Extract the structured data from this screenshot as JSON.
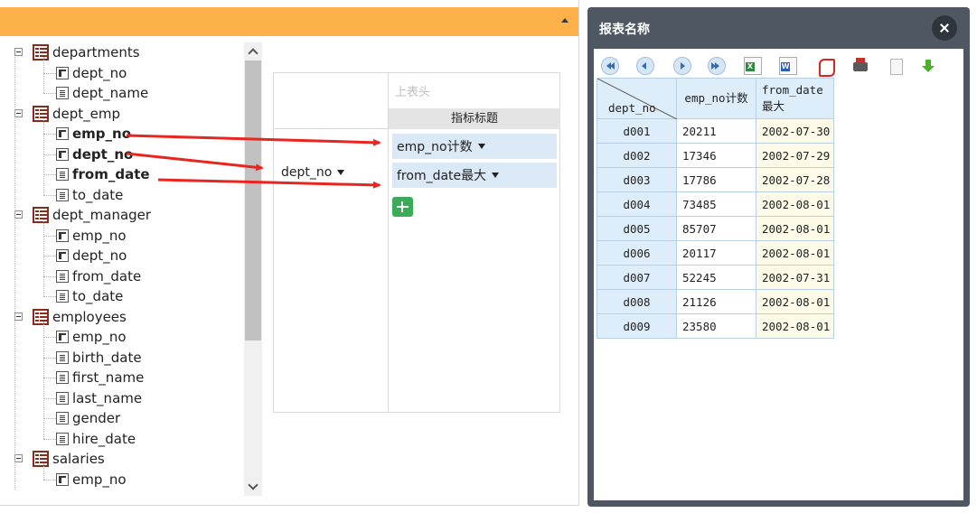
{
  "tree": {
    "tables": [
      {
        "name": "departments",
        "fields": [
          {
            "name": "dept_no",
            "type": "key",
            "bold": false
          },
          {
            "name": "dept_name",
            "type": "col",
            "bold": false
          }
        ]
      },
      {
        "name": "dept_emp",
        "fields": [
          {
            "name": "emp_no",
            "type": "key",
            "bold": true
          },
          {
            "name": "dept_no",
            "type": "key",
            "bold": true
          },
          {
            "name": "from_date",
            "type": "col",
            "bold": true
          },
          {
            "name": "to_date",
            "type": "col",
            "bold": false
          }
        ]
      },
      {
        "name": "dept_manager",
        "fields": [
          {
            "name": "emp_no",
            "type": "key",
            "bold": false
          },
          {
            "name": "dept_no",
            "type": "key",
            "bold": false
          },
          {
            "name": "from_date",
            "type": "col",
            "bold": false
          },
          {
            "name": "to_date",
            "type": "col",
            "bold": false
          }
        ]
      },
      {
        "name": "employees",
        "fields": [
          {
            "name": "emp_no",
            "type": "key",
            "bold": false
          },
          {
            "name": "birth_date",
            "type": "col",
            "bold": false
          },
          {
            "name": "first_name",
            "type": "col",
            "bold": false
          },
          {
            "name": "last_name",
            "type": "col",
            "bold": false
          },
          {
            "name": "gender",
            "type": "col",
            "bold": false
          },
          {
            "name": "hire_date",
            "type": "col",
            "bold": false
          }
        ]
      },
      {
        "name": "salaries",
        "fields": [
          {
            "name": "emp_no",
            "type": "key",
            "bold": false
          }
        ]
      }
    ]
  },
  "pivot": {
    "col_header_placeholder": "上表头",
    "metric_title": "指标标题",
    "row_dimension": "dept_no",
    "measures": [
      "emp_no计数",
      "from_date最大"
    ]
  },
  "dialog": {
    "title": "报表名称",
    "toolbar": [
      "first-page-icon",
      "prev-page-icon",
      "next-page-icon",
      "last-page-icon",
      "excel-export-icon",
      "word-export-icon",
      "pdf-export-icon",
      "print-icon",
      "blank-doc-icon",
      "download-icon"
    ],
    "table": {
      "corner_label": "dept_no",
      "col1_header": "emp_no计数",
      "col2_header": "from_date最大",
      "rows": [
        {
          "dept": "d001",
          "count": "20211",
          "max_date": "2002-07-30"
        },
        {
          "dept": "d002",
          "count": "17346",
          "max_date": "2002-07-29"
        },
        {
          "dept": "d003",
          "count": "17786",
          "max_date": "2002-07-28"
        },
        {
          "dept": "d004",
          "count": "73485",
          "max_date": "2002-08-01"
        },
        {
          "dept": "d005",
          "count": "85707",
          "max_date": "2002-08-01"
        },
        {
          "dept": "d006",
          "count": "20117",
          "max_date": "2002-08-01"
        },
        {
          "dept": "d007",
          "count": "52245",
          "max_date": "2002-07-31"
        },
        {
          "dept": "d008",
          "count": "21126",
          "max_date": "2002-08-01"
        },
        {
          "dept": "d009",
          "count": "23580",
          "max_date": "2002-08-01"
        }
      ]
    }
  },
  "colors": {
    "header_bar": "#fdb14a",
    "arrow": "#e8251f",
    "dialog_frame": "#4f5862",
    "measure_bg": "#dbe8f6"
  }
}
